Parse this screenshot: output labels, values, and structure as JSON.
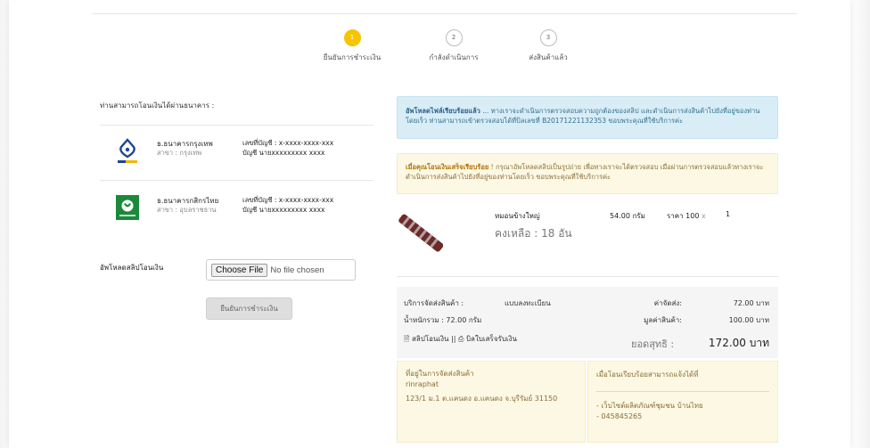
{
  "steps": [
    {
      "num": "1",
      "label": "ยืนยันการชำระเงิน",
      "active": true
    },
    {
      "num": "2",
      "label": "กำลังดำเนินการ",
      "active": false
    },
    {
      "num": "3",
      "label": "ส่งสินค้าแล้ว",
      "active": false
    }
  ],
  "left": {
    "title": "ท่านสามารถโอนเงินได้ผ่านธนาคาร :",
    "banks": [
      {
        "name": "ธ.ธนาคารกรุงเทพ",
        "branch": "สาขา : กรุงเทพ",
        "account": "เลขที่บัญชี : x-xxxx-xxxx-xxx",
        "owner": "บัญชี นายxxxxxxxxx xxxx",
        "logo": "bangkok-bank-logo",
        "color": "#1e4598"
      },
      {
        "name": "ธ.ธนาคารกสิกรไทย",
        "branch": "สาขา : อุบลราชธาน",
        "account": "เลขที่บัญชี : x-xxxx-xxxx-xxx",
        "owner": "บัญชี นายxxxxxxxxx xxxx",
        "logo": "kasikorn-bank-logo",
        "color": "#1a8a3a"
      }
    ],
    "upload_label": "อัพโหลดสลิปโอนเงิน",
    "file_button": "Choose File",
    "file_status": "No file chosen",
    "confirm_button": "ยืนยันการชำระเงิน"
  },
  "alerts": {
    "info_bold": "อัพโหลดไฟล์เรียบร้อยแล้ว",
    "info_text": " ... ทางเราจะดำเนินการตรวจสอบความถูกต้องของสลิป และดำเนินการส่งสินค้าไปยังที่อยู่ของท่านโดยเร็ว ท่านสามารถเข้าตรวจสอบได้ที่บิลเลขที่ B20171221132353 ขอบพระคุณที่ใช้บริการค่ะ",
    "warn_bold": "เมื่อคุณโอนเงินเสร็จเรียบร้อย",
    "warn_text": " ! กรุณาอัพโหลดสลิปเป็นรูปถ่าย เพื่อทางเราจะได้ตรวจสอบ เมื่อผ่านการตรวจสอบแล้วทางเราจะดำเนินการส่งสินค้าไปยังที่อยู่ของท่านโดยเร็ว ขอบพระคุณที่ใช้บริการค่ะ"
  },
  "product": {
    "name": "หมอนข้างใหญ่",
    "remaining": "คงเหลือ : 18 อัน",
    "weight": "54.00 กรัม",
    "price": "ราคา 100",
    "x": "x",
    "qty": "1"
  },
  "summary": {
    "shipping_service_label": "บริการจัดส่งสินค้า :",
    "shipping_service_value": "แบบลงทะเบียน",
    "shipping_cost_label": "ค่าจัดส่ง:",
    "shipping_cost_value": "72.00 บาท",
    "total_weight": "น้ำหนักรวม : 72.00 กรัม",
    "goods_value_label": "มูลค่าสินค้า:",
    "goods_value": "100.00 บาท",
    "slip_link": "สลิปโอนเงิน",
    "link_separator": "||",
    "receipt_link": "บิลใบเสร็จรับเงิน",
    "net_label": "ยอดสุทธิ :",
    "net_value": "172.00 บาท"
  },
  "address": {
    "title": "ที่อยู่ในการจัดส่งสินค้า",
    "name": "rinraphat",
    "line": "123/1 ม.1 ต.แคนดง อ.แคนดง จ.บุรีรัมย์ 31150"
  },
  "notify": {
    "title": "เมื่อโอนเรียบร้อยสามารถแจ้งได้ที่",
    "line1": "- เว็บไซต์ผลิตภัณฑ์ชุมชน บ้านไทย",
    "line2": "- 045845265"
  }
}
